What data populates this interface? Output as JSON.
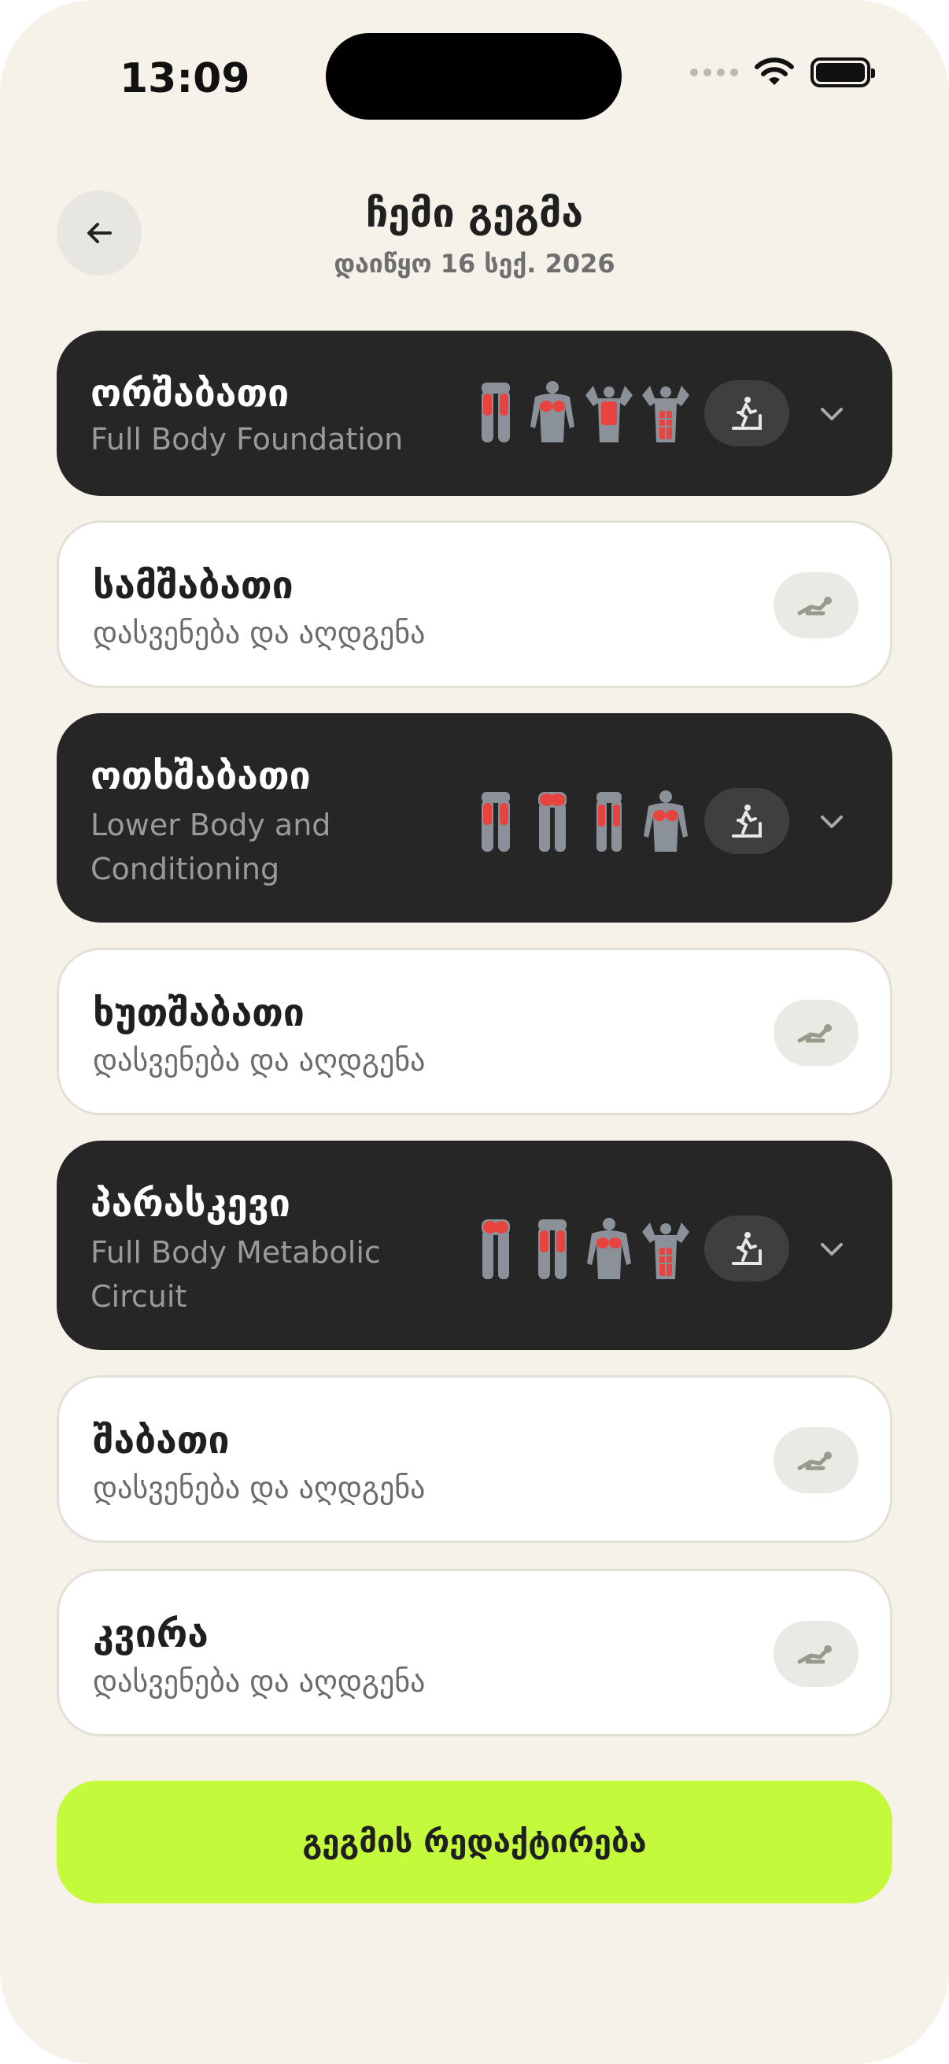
{
  "status_bar": {
    "time": "13:09"
  },
  "header": {
    "title": "ჩემი გეგმა",
    "subtitle": "დაიწყო 16 სექ. 2026"
  },
  "days": [
    {
      "name": "ორშაბათი",
      "subtitle": "Full Body Foundation",
      "type": "workout",
      "type_icon": "treadmill-icon",
      "muscle_icons": [
        "legs-front-icon",
        "chest-icon",
        "back-icon",
        "core-icon"
      ]
    },
    {
      "name": "სამშაბათი",
      "subtitle": "დასვენება და აღდგენა",
      "type": "rest",
      "type_icon": "rest-lying-icon"
    },
    {
      "name": "ოთხშაბათი",
      "subtitle": "Lower Body and Conditioning",
      "type": "workout",
      "type_icon": "treadmill-icon",
      "muscle_icons": [
        "legs-front-icon",
        "glutes-icon",
        "hamstrings-icon",
        "chest-icon"
      ]
    },
    {
      "name": "ხუთშაბათი",
      "subtitle": "დასვენება და აღდგენა",
      "type": "rest",
      "type_icon": "rest-lying-icon"
    },
    {
      "name": "პარასკევი",
      "subtitle": "Full Body Metabolic Circuit",
      "type": "workout",
      "type_icon": "treadmill-icon",
      "muscle_icons": [
        "glutes-icon",
        "legs-front-icon",
        "chest-icon",
        "core-icon"
      ]
    },
    {
      "name": "შაბათი",
      "subtitle": "დასვენება და აღდგენა",
      "type": "rest",
      "type_icon": "rest-lying-icon"
    },
    {
      "name": "კვირა",
      "subtitle": "დასვენება და აღდგენა",
      "type": "rest",
      "type_icon": "rest-lying-icon"
    }
  ],
  "edit_button": {
    "label": "გეგმის რედაქტირება"
  },
  "colors": {
    "background": "#f6f2ea",
    "dark_card": "#262626",
    "accent": "#c3fb3c",
    "muscle_highlight": "#e8433f",
    "body_gray": "#8a9198"
  }
}
